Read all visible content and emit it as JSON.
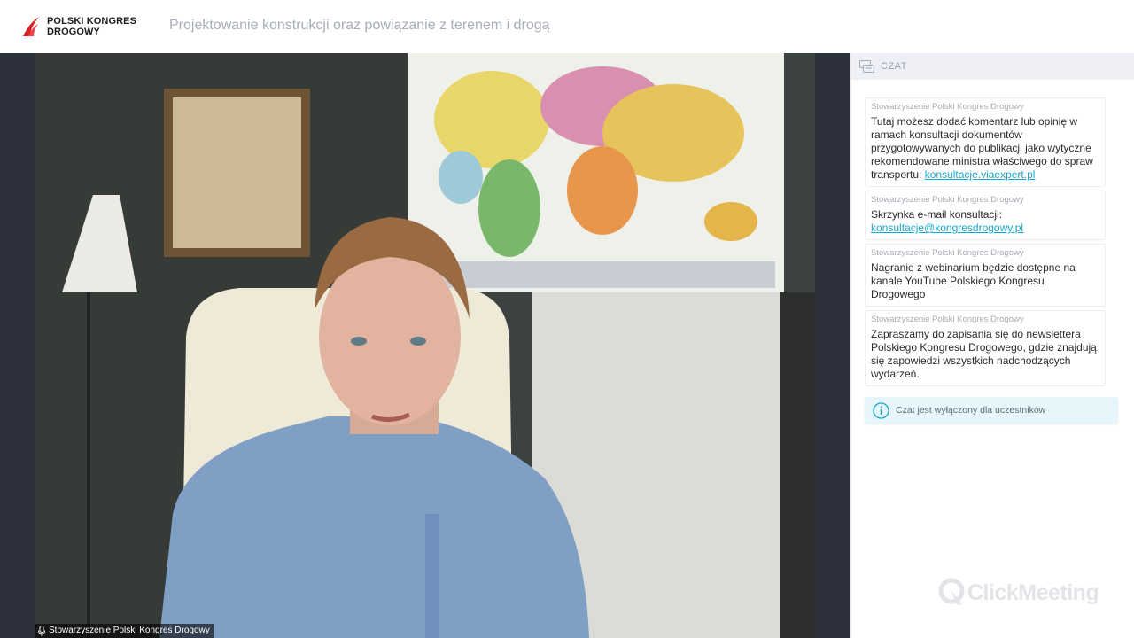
{
  "header": {
    "logo_line1": "POLSKI KONGRES",
    "logo_line2": "DROGOWY",
    "title": "Projektowanie konstrukcji oraz powiązanie z terenem i drogą"
  },
  "video": {
    "speaker_name": "Stowarzyszenie Polski Kongres Drogowy"
  },
  "chat": {
    "header": "CZAT",
    "messages": [
      {
        "author": "Stowarzyszenie Polski Kongres Drogowy",
        "text": "Tutaj możesz dodać komentarz lub opinię w ramach konsultacji dokumentów przygotowywanych do publikacji jako wytyczne rekomendowane ministra właściwego do spraw transportu: ",
        "link": "konsultacje.viaexpert.pl"
      },
      {
        "author": "Stowarzyszenie Polski Kongres Drogowy",
        "text": "Skrzynka e-mail konsultacji: ",
        "link": "konsultacje@kongresdrogowy.pl"
      },
      {
        "author": "Stowarzyszenie Polski Kongres Drogowy",
        "text": "Nagranie z webinarium będzie dostępne na kanale YouTube Polskiego Kongresu Drogowego"
      },
      {
        "author": "Stowarzyszenie Polski Kongres Drogowy",
        "text": "Zapraszamy do zapisania się do newslettera Polskiego Kongresu Drogowego, gdzie znajdują się zapowiedzi wszystkich nadchodzących wydarzeń."
      }
    ],
    "notice": "Czat jest wyłączony dla uczestników",
    "brand": "ClickMeeting"
  },
  "colors": {
    "accent": "#17a6c9",
    "logo_red": "#d72027",
    "stage_bg": "#2b303a"
  }
}
